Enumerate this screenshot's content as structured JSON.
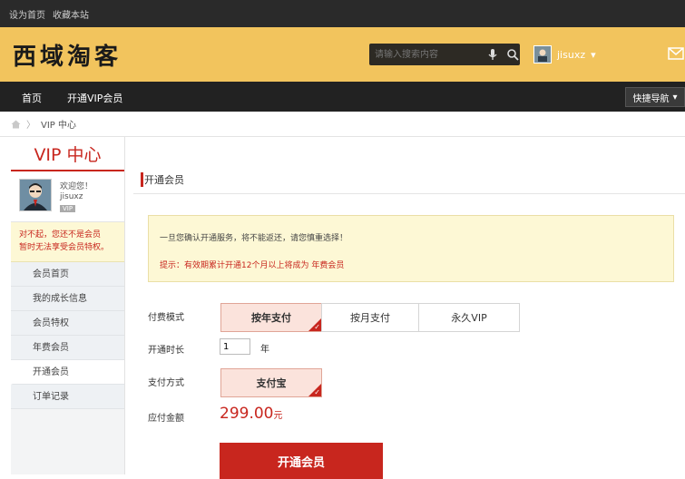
{
  "topbar": {
    "set_home": "设为首页",
    "bookmark": "收藏本站"
  },
  "header": {
    "logo": "西域淘客",
    "search_placeholder": "请输入搜索内容",
    "username": "jisuxz",
    "user_caret": "▾"
  },
  "nav": {
    "home": "首页",
    "vip": "开通VIP会员",
    "quick_nav": "快捷导航",
    "quick_caret": "▾"
  },
  "breadcrumb": {
    "sep": "〉",
    "current": "VIP 中心"
  },
  "sidebar": {
    "title": "VIP 中心",
    "welcome": "欢迎您！",
    "username": "jisuxz",
    "vip_badge": "VIP",
    "warning_line1": "对不起，您还不是会员",
    "warning_line2": "暂时无法享受会员特权。",
    "menu": [
      "会员首页",
      "我的成长信息",
      "会员特权",
      "年费会员",
      "开通会员",
      "订单记录"
    ]
  },
  "main": {
    "section_title": "开通会员",
    "notice_line1": "一旦您确认开通服务，将不能返还，请您慎重选择！",
    "notice_tip": "提示：有效期累计开通12个月以上将成为 年费会员",
    "pay_mode_label": "付费模式",
    "pay_modes": [
      "按年支付",
      "按月支付",
      "永久VIP"
    ],
    "duration_label": "开通时长",
    "duration_value": "1",
    "duration_unit": "年",
    "pay_method_label": "支付方式",
    "pay_method": "支付宝",
    "amount_label": "应付金额",
    "amount": "299.00",
    "amount_unit": "元",
    "submit_label": "开通会员"
  },
  "colors": {
    "accent": "#c8261e",
    "header": "#f2c45d",
    "nav": "#222222"
  }
}
